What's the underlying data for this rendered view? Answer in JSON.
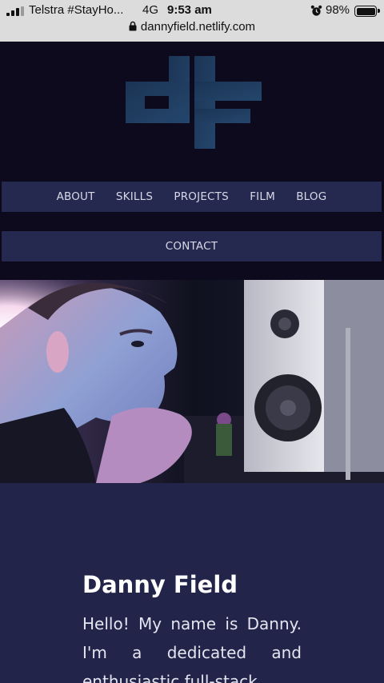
{
  "status_bar": {
    "carrier": "Telstra #StayHo...",
    "network": "4G",
    "time": "9:53 am",
    "battery_percent": "98%",
    "battery_level": 0.98,
    "icons": [
      "signal-bars-icon",
      "alarm-icon",
      "battery-icon"
    ]
  },
  "browser": {
    "url": "dannyfield.netlify.com",
    "icon": "lock-icon"
  },
  "site": {
    "logo_text": "dF",
    "nav": {
      "items": [
        {
          "label": "ABOUT"
        },
        {
          "label": "SKILLS"
        },
        {
          "label": "PROJECTS"
        },
        {
          "label": "FILM"
        },
        {
          "label": "BLOG"
        }
      ],
      "contact_label": "CONTACT"
    },
    "about": {
      "name": "Danny Field",
      "bio": "Hello! My name is Danny. I'm a dedicated and enthusiastic full-stack"
    }
  },
  "colors": {
    "header_bg": "#0e0a1e",
    "nav_bg": "#25294f",
    "page_bg": "#23244a",
    "logo": "#1f3a5e"
  }
}
